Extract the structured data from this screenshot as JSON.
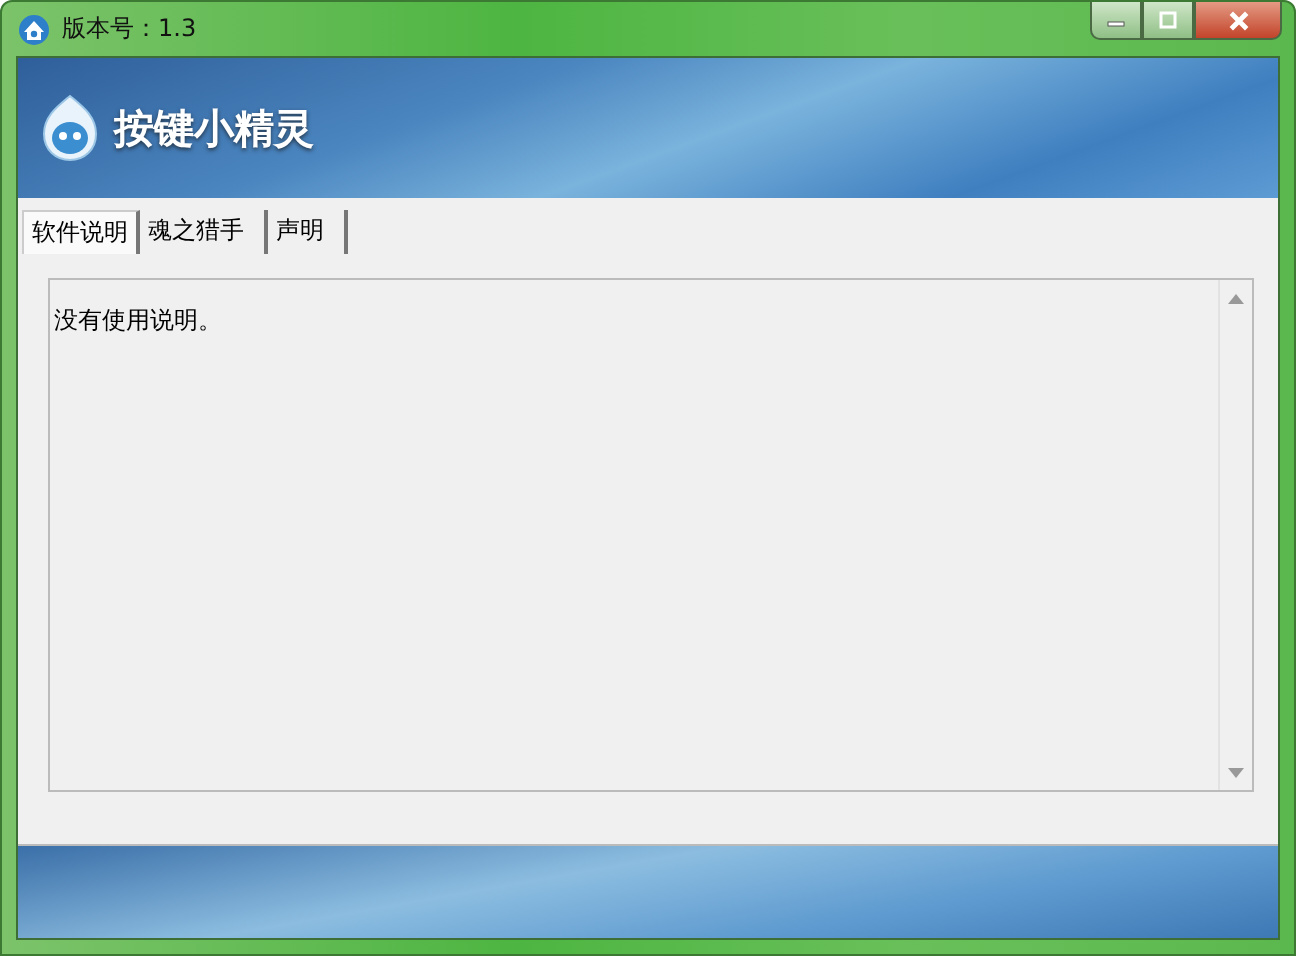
{
  "window": {
    "title": "版本号：1.3"
  },
  "banner": {
    "app_name": "按键小精灵"
  },
  "tabs": [
    {
      "label": "软件说明",
      "selected": true
    },
    {
      "label": "魂之猎手",
      "selected": false
    },
    {
      "label": "声明",
      "selected": false
    }
  ],
  "content": {
    "text": "没有使用说明。"
  }
}
